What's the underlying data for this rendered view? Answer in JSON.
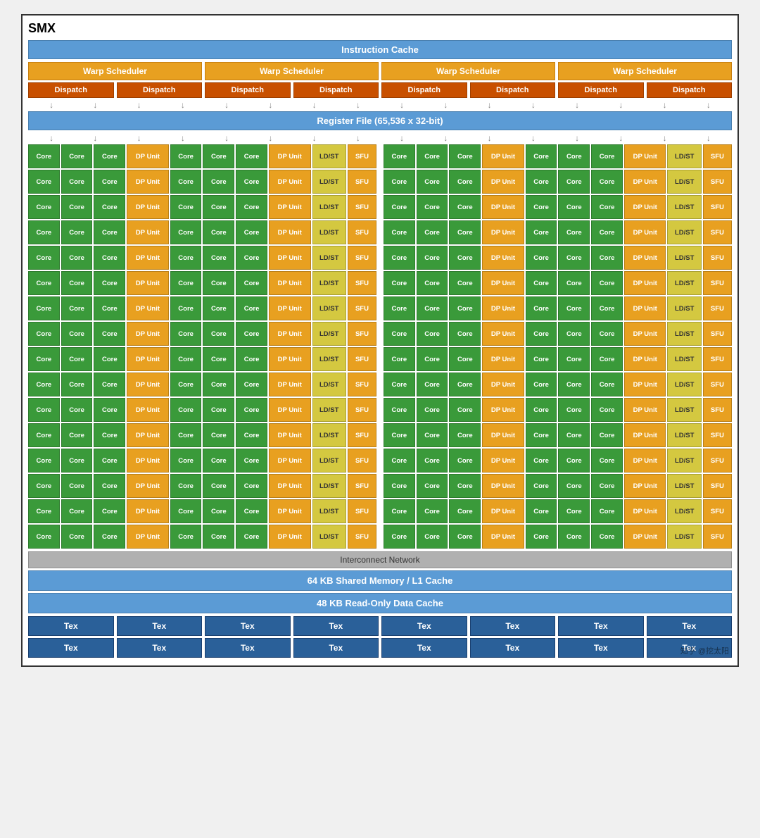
{
  "title": "SMX",
  "instruction_cache": "Instruction Cache",
  "warp_schedulers": [
    "Warp Scheduler",
    "Warp Scheduler",
    "Warp Scheduler",
    "Warp Scheduler"
  ],
  "dispatch_units": [
    "Dispatch",
    "Dispatch",
    "Dispatch",
    "Dispatch",
    "Dispatch",
    "Dispatch",
    "Dispatch",
    "Dispatch"
  ],
  "register_file": "Register File (65,536 x 32-bit)",
  "interconnect": "Interconnect Network",
  "shared_memory": "64 KB Shared Memory / L1 Cache",
  "readonly_cache": "48 KB Read-Only Data Cache",
  "tex_rows": [
    [
      "Tex",
      "Tex",
      "Tex",
      "Tex",
      "Tex",
      "Tex",
      "Tex",
      "Tex"
    ],
    [
      "Tex",
      "Tex",
      "Tex",
      "Tex",
      "Tex",
      "Tex",
      "Tex",
      "Tex"
    ]
  ],
  "watermark": "知乎 @挖太阳",
  "num_core_rows": 16
}
